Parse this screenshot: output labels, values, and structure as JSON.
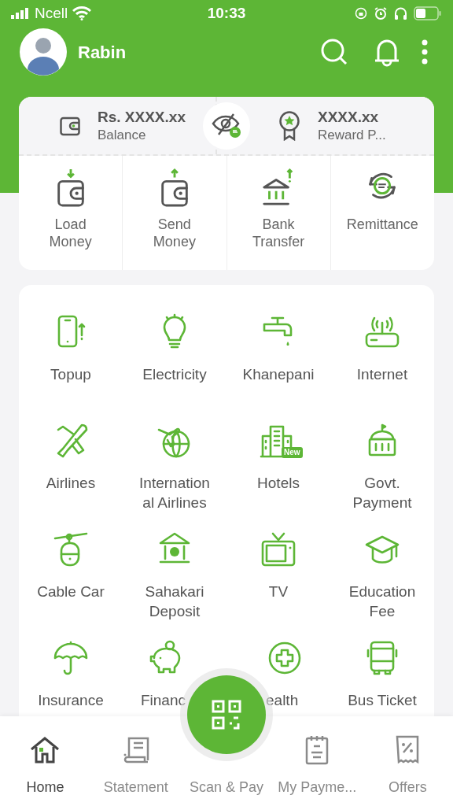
{
  "status_bar": {
    "carrier": "Ncell",
    "time": "10:33"
  },
  "header": {
    "user_name": "Rabin"
  },
  "balance_card": {
    "balance": {
      "amount": "Rs. XXXX.xx",
      "label": "Balance"
    },
    "reward": {
      "amount": "XXXX.xx",
      "label": "Reward P..."
    }
  },
  "quick_actions": [
    {
      "kind": "load",
      "label": "Load\nMoney"
    },
    {
      "kind": "send",
      "label": "Send\nMoney"
    },
    {
      "kind": "bank",
      "label": "Bank\nTransfer"
    },
    {
      "kind": "remit",
      "label": "Remittance"
    }
  ],
  "services": [
    {
      "kind": "topup",
      "label": "Topup"
    },
    {
      "kind": "bulb",
      "label": "Electricity"
    },
    {
      "kind": "tap",
      "label": "Khanepani"
    },
    {
      "kind": "router",
      "label": "Internet"
    },
    {
      "kind": "plane",
      "label": "Airlines"
    },
    {
      "kind": "globe",
      "label": "Internation\nal Airlines"
    },
    {
      "kind": "hotel",
      "label": "Hotels",
      "badge": "New"
    },
    {
      "kind": "govt",
      "label": "Govt.\nPayment"
    },
    {
      "kind": "cable",
      "label": "Cable Car"
    },
    {
      "kind": "coop",
      "label": "Sahakari\nDeposit"
    },
    {
      "kind": "tv",
      "label": "TV"
    },
    {
      "kind": "cap",
      "label": "Education\nFee"
    },
    {
      "kind": "umbrella",
      "label": "Insurance"
    },
    {
      "kind": "piggy",
      "label": "Financ",
      "clipped_end": true
    },
    {
      "kind": "health",
      "label": "ealth",
      "clipped_start": true
    },
    {
      "kind": "bus",
      "label": "Bus Ticket"
    }
  ],
  "bottom_nav": [
    {
      "kind": "home",
      "label": "Home",
      "selected": true
    },
    {
      "kind": "statement",
      "label": "Statement",
      "selected": false
    },
    {
      "kind": "scan",
      "label": "Scan & Pay",
      "selected": false
    },
    {
      "kind": "payments",
      "label": "My Payme...",
      "selected": false
    },
    {
      "kind": "offers",
      "label": "Offers",
      "selected": false
    }
  ]
}
